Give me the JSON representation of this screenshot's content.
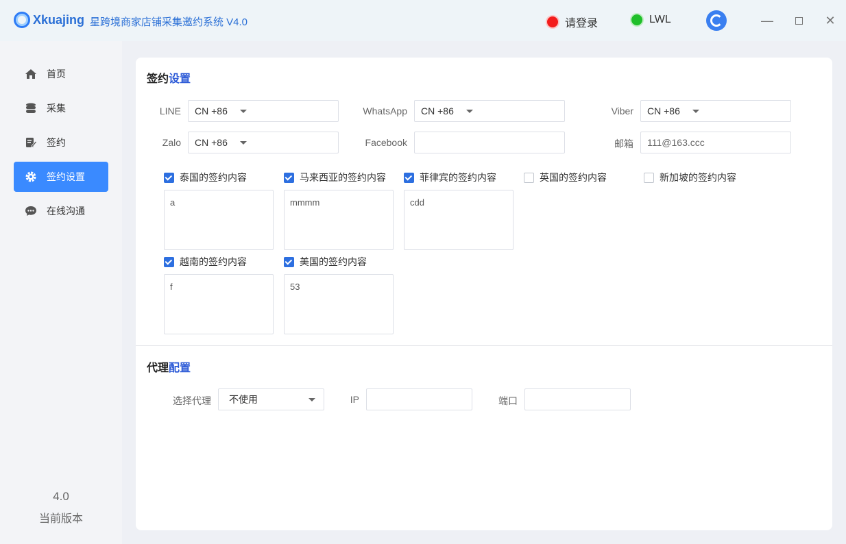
{
  "titlebar": {
    "brand": "Xkuajing",
    "app_title": "星跨境商家店铺采集邀约系统 V4.0",
    "login_status": "请登录",
    "user_status": "LWL",
    "colors": {
      "brand": "#2a6fd6",
      "status_red": "#f31c1c",
      "status_green": "#1fbf2a"
    }
  },
  "sidebar": {
    "items": [
      {
        "label": "首页",
        "icon": "home-icon"
      },
      {
        "label": "采集",
        "icon": "database-icon"
      },
      {
        "label": "签约",
        "icon": "edit-document-icon"
      },
      {
        "label": "签约设置",
        "icon": "gear-icon",
        "active": true
      },
      {
        "label": "在线沟通",
        "icon": "chat-icon"
      }
    ],
    "version_number": "4.0",
    "version_label": "当前版本"
  },
  "sign_settings": {
    "title_main": "签约",
    "title_accent": "设置",
    "fields": {
      "line": {
        "label": "LINE",
        "value": "CN +86"
      },
      "whatsapp": {
        "label": "WhatsApp",
        "value": "CN +86"
      },
      "viber": {
        "label": "Viber",
        "value": "CN +86"
      },
      "zalo": {
        "label": "Zalo",
        "value": "CN +86"
      },
      "facebook": {
        "label": "Facebook",
        "value": ""
      },
      "email": {
        "label": "邮箱",
        "value": "111@163.ccc"
      }
    },
    "countries": [
      {
        "label": "泰国的签约内容",
        "checked": true,
        "content": "a"
      },
      {
        "label": "马来西亚的签约内容",
        "checked": true,
        "content": "mmmm"
      },
      {
        "label": "菲律宾的签约内容",
        "checked": true,
        "content": "cdd"
      },
      {
        "label": "英国的签约内容",
        "checked": false,
        "content": ""
      },
      {
        "label": "新加坡的签约内容",
        "checked": false,
        "content": ""
      },
      {
        "label": "越南的签约内容",
        "checked": true,
        "content": "f"
      },
      {
        "label": "美国的签约内容",
        "checked": true,
        "content": "53"
      }
    ]
  },
  "proxy": {
    "title_main": "代理",
    "title_accent": "配置",
    "select_label": "选择代理",
    "select_value": "不使用",
    "ip_label": "IP",
    "ip_value": "",
    "port_label": "端口",
    "port_value": ""
  }
}
